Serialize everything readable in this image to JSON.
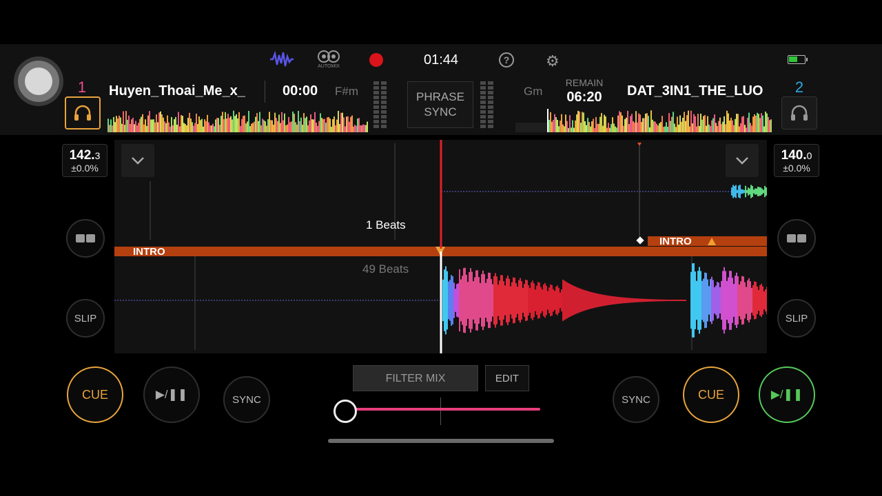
{
  "topbar": {
    "time": "01:44",
    "automix_label": "AUTOMIX",
    "icons": [
      "waveform-icon",
      "automix-icon",
      "record-icon",
      "help-icon",
      "settings-icon",
      "battery-icon"
    ],
    "help_glyph": "?",
    "gear_glyph": "⚙",
    "battery_level": 0.55,
    "record_color": "#d9141a",
    "battery_color": "#2fc63a"
  },
  "deck1": {
    "number": "1",
    "number_color": "#f04c8f",
    "title": "Huyen_Thoai_Me_x_",
    "elapsed": "00:00",
    "key": "F#m",
    "bpm_whole": "142.",
    "bpm_decimal": "3",
    "bpm_adjust": "±0.0%",
    "cue_label": "CUE",
    "play_label": "▶/❚❚",
    "sync_label": "SYNC",
    "slip_label": "SLIP",
    "cue_label_on_wave": "INTRO",
    "beats_label": "1 Beats"
  },
  "deck2": {
    "number": "2",
    "number_color": "#2ba8e4",
    "title": "DAT_3IN1_THE_LUO",
    "key": "Gm",
    "remain_label": "REMAIN",
    "remain_time": "06:20",
    "bpm_whole": "140.",
    "bpm_decimal": "0",
    "bpm_adjust": "±0.0%",
    "cue_label": "CUE",
    "play_label": "▶/❚❚",
    "sync_label": "SYNC",
    "slip_label": "SLIP",
    "cue_label_on_wave": "INTRO",
    "beats_label": "49 Beats"
  },
  "center": {
    "phrase_sync_line1": "PHRASE",
    "phrase_sync_line2": "SYNC",
    "filter_mix_label": "FILTER MIX",
    "edit_label": "EDIT",
    "crossfader_position": 0.0
  },
  "colors": {
    "accent_orange": "#e8a43c",
    "play_green": "#56c85a",
    "crossfader_pink": "#e83e7b",
    "playhead_red": "#e0202a",
    "cue_bar": "#b5400f"
  }
}
